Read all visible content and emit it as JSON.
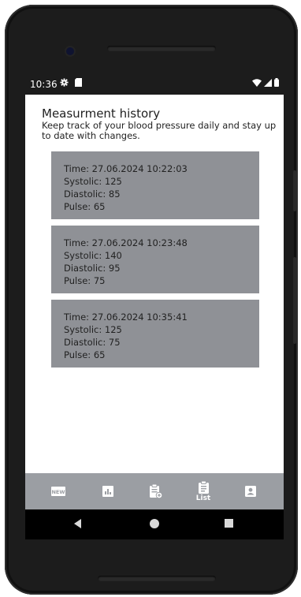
{
  "status_bar": {
    "time": "10:36",
    "icons_left": [
      "gear-icon",
      "sd-card-icon"
    ],
    "icons_right": [
      "wifi-icon",
      "signal-icon",
      "battery-icon"
    ]
  },
  "screen": {
    "title": "Measurment history",
    "subtitle": "Keep track of your blood pressure daily and stay up to date with changes.",
    "records": [
      {
        "time": "Time: 27.06.2024 10:22:03",
        "systolic": "Systolic: 125",
        "diastolic": "Diastolic: 85",
        "pulse": "Pulse: 65"
      },
      {
        "time": "Time: 27.06.2024 10:23:48",
        "systolic": "Systolic: 140",
        "diastolic": "Diastolic: 95",
        "pulse": "Pulse: 75"
      },
      {
        "time": "Time: 27.06.2024 10:35:41",
        "systolic": "Systolic: 125",
        "diastolic": "Diastolic: 75",
        "pulse": "Pulse: 65"
      }
    ]
  },
  "bottom_nav": {
    "items": [
      {
        "icon": "new-icon",
        "badge_text": "NEW",
        "label": ""
      },
      {
        "icon": "chart-icon",
        "label": ""
      },
      {
        "icon": "clipboard-add-icon",
        "label": ""
      },
      {
        "icon": "clipboard-list-icon",
        "label": "List",
        "active": true
      },
      {
        "icon": "profile-icon",
        "label": ""
      }
    ],
    "background": "#9b9ea3",
    "record_background": "#8f9196"
  },
  "system_nav": {
    "buttons": [
      "back-icon",
      "home-icon",
      "recents-icon"
    ]
  }
}
